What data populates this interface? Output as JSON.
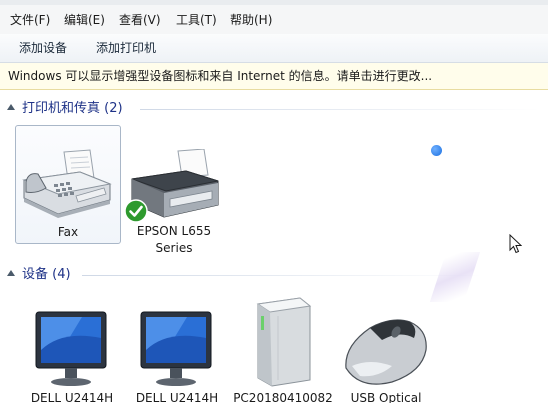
{
  "menubar": {
    "items": [
      {
        "label": "文件(F)"
      },
      {
        "label": "编辑(E)"
      },
      {
        "label": "查看(V)"
      },
      {
        "label": "工具(T)"
      },
      {
        "label": "帮助(H)"
      }
    ]
  },
  "toolbar": {
    "add_device_label": "添加设备",
    "add_printer_label": "添加打印机"
  },
  "infobar": {
    "text": "Windows 可以显示增强型设备图标和来自 Internet 的信息。请单击进行更改..."
  },
  "sections": {
    "printers": {
      "title": "打印机和传真 (2)",
      "devices": [
        {
          "name": "Fax",
          "icon": "fax-icon"
        },
        {
          "name_line1": "EPSON L655",
          "name_line2": "Series",
          "icon": "printer-icon",
          "default": true
        }
      ]
    },
    "devices": {
      "title": "设备 (4)",
      "devices": [
        {
          "name": "DELL U2414H",
          "icon": "monitor-icon"
        },
        {
          "name": "DELL U2414H",
          "icon": "monitor-icon"
        },
        {
          "name": "PC20180410082",
          "icon": "computer-icon"
        },
        {
          "name": "USB Optical",
          "icon": "mouse-icon"
        }
      ]
    }
  },
  "colors": {
    "section_title": "#1e3287",
    "infobar_bg": "#fffdeb",
    "default_check": "#2e9a2e"
  }
}
